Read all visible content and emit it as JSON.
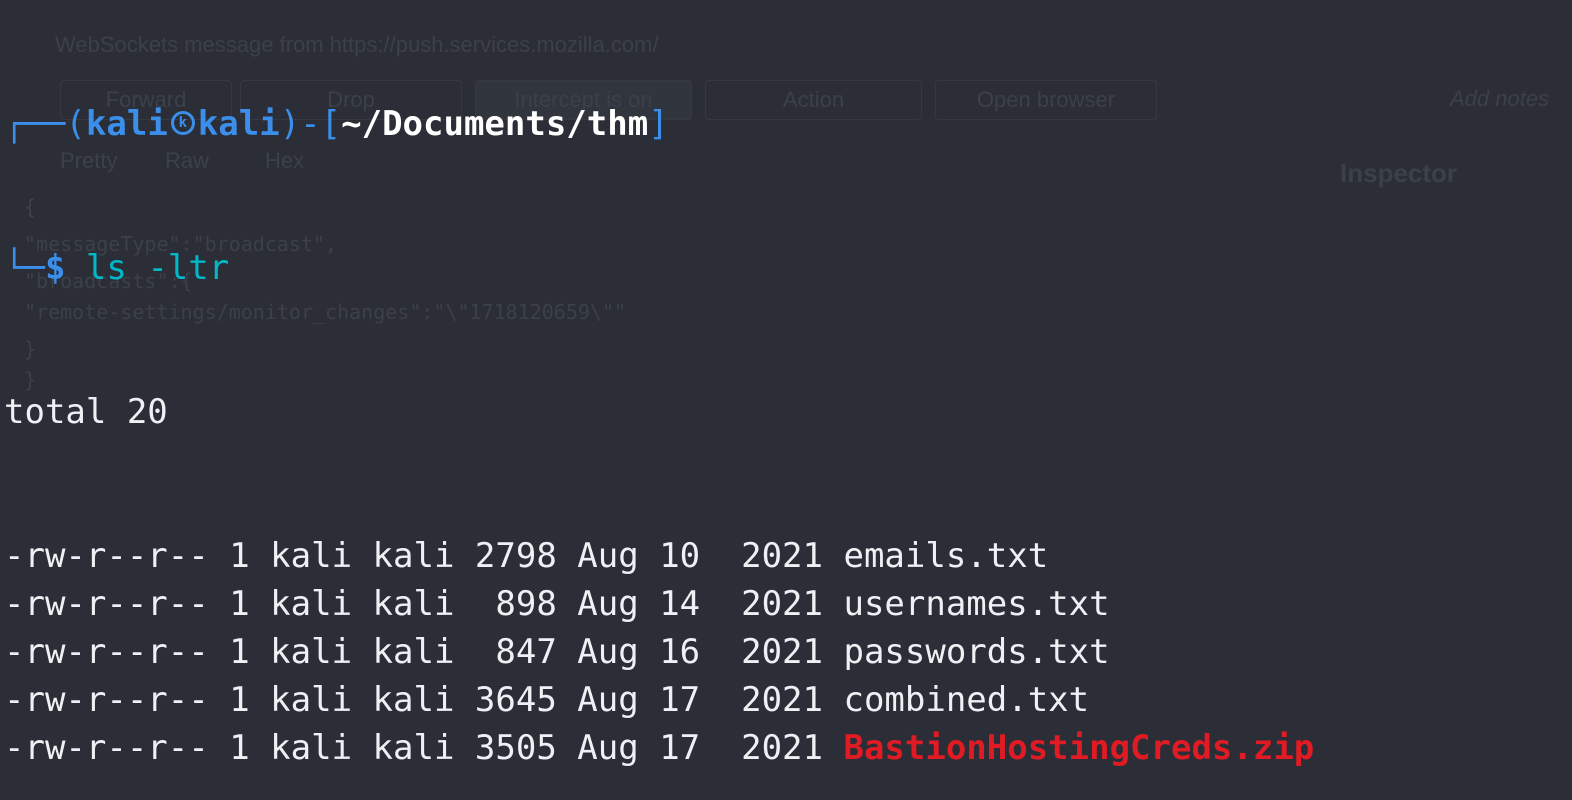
{
  "background_window": {
    "notice": "WebSockets message from https://push.services.mozilla.com/",
    "toolbar": [
      "Forward",
      "Drop",
      "Intercept is on",
      "Action",
      "Open browser"
    ],
    "notes_placeholder": "Add notes",
    "tabs": [
      "Pretty",
      "Raw",
      "Hex"
    ],
    "inspector_title": "Inspector",
    "code": [
      "{",
      "  \"messageType\":\"broadcast\",",
      "  \"broadcasts\":{",
      "    \"remote-settings/monitor_changes\":\"\\\"1718120659\\\"\"",
      "  }",
      "}"
    ]
  },
  "prompt": {
    "user": "kali",
    "host": "kali",
    "path": "~/Documents/thm",
    "symbol": "$",
    "command": "ls -ltr"
  },
  "total": "total 20",
  "files": [
    {
      "perms": "-rw-r--r--",
      "links": "1",
      "owner": "kali",
      "group": "kali",
      "size": "2798",
      "month": "Aug",
      "day": "10",
      "year": "2021",
      "name": "emails.txt",
      "type": "text"
    },
    {
      "perms": "-rw-r--r--",
      "links": "1",
      "owner": "kali",
      "group": "kali",
      "size": " 898",
      "month": "Aug",
      "day": "14",
      "year": "2021",
      "name": "usernames.txt",
      "type": "text"
    },
    {
      "perms": "-rw-r--r--",
      "links": "1",
      "owner": "kali",
      "group": "kali",
      "size": " 847",
      "month": "Aug",
      "day": "16",
      "year": "2021",
      "name": "passwords.txt",
      "type": "text"
    },
    {
      "perms": "-rw-r--r--",
      "links": "1",
      "owner": "kali",
      "group": "kali",
      "size": "3645",
      "month": "Aug",
      "day": "17",
      "year": "2021",
      "name": "combined.txt",
      "type": "text"
    },
    {
      "perms": "-rw-r--r--",
      "links": "1",
      "owner": "kali",
      "group": "kali",
      "size": "3505",
      "month": "Aug",
      "day": "17",
      "year": "2021",
      "name": "BastionHostingCreds.zip",
      "type": "archive"
    }
  ],
  "colors": {
    "background": "#2b2e36",
    "prompt": "#3b8eea",
    "command": "#00b8c8",
    "archive": "#e01b24",
    "text": "#eef0f4"
  }
}
